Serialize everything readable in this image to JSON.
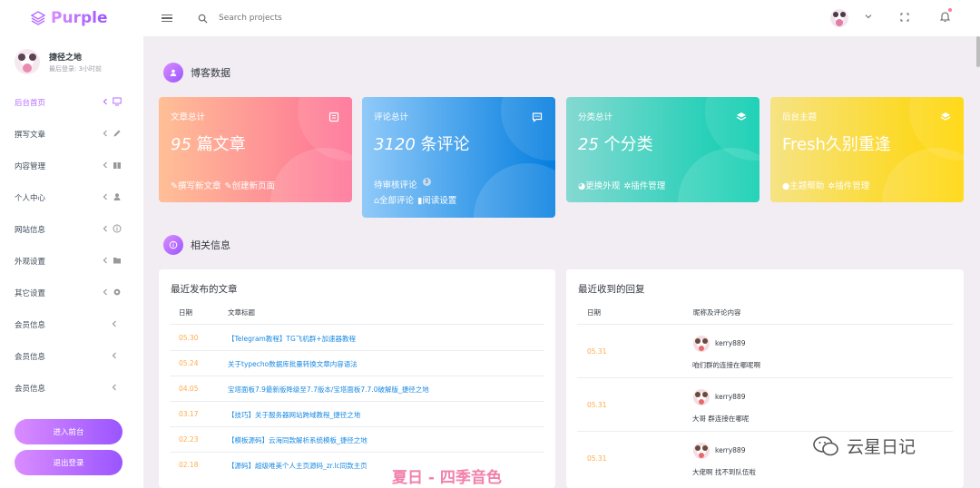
{
  "app": {
    "name": "Purple"
  },
  "search": {
    "placeholder": "Search projects"
  },
  "profile": {
    "name": "捷径之地",
    "status": "最后登录: 3小时前"
  },
  "sidebar": {
    "items": [
      {
        "label": "后台首页",
        "icon": "monitor-icon"
      },
      {
        "label": "撰写文章",
        "icon": "pencil-icon"
      },
      {
        "label": "内容管理",
        "icon": "book-icon"
      },
      {
        "label": "个人中心",
        "icon": "user-icon"
      },
      {
        "label": "网站信息",
        "icon": "info-icon"
      },
      {
        "label": "外观设置",
        "icon": "folder-icon"
      },
      {
        "label": "其它设置",
        "icon": "gear-icon"
      },
      {
        "label": "会员信息",
        "icon": ""
      },
      {
        "label": "会员信息",
        "icon": ""
      },
      {
        "label": "会员信息",
        "icon": ""
      }
    ],
    "front_button": "进入前台",
    "logout_button": "退出登录"
  },
  "blog_section": {
    "title": "博客数据"
  },
  "stats": [
    {
      "label": "文章总计",
      "number": "95",
      "unit": " 篇文章",
      "links": [
        "撰写新文章",
        "创建新页面"
      ],
      "color": "#fe7c96"
    },
    {
      "label": "评论总计",
      "number": "3120",
      "unit": " 条评论",
      "pending_label": "待审核评论",
      "pending_count": "3",
      "links": [
        "全部评论",
        "阅读设置"
      ],
      "color": "#198ae3"
    },
    {
      "label": "分类总计",
      "number": "25",
      "unit": " 个分类",
      "links": [
        "更换外观",
        "插件管理"
      ],
      "color": "#1bcfb4"
    },
    {
      "label": "后台主题",
      "value": "Fresh久别重逢",
      "links": [
        "主题帮助",
        "插件管理"
      ],
      "color": "#fed713"
    }
  ],
  "info_section": {
    "title": "相关信息"
  },
  "recent_posts": {
    "title": "最近发布的文章",
    "headers": [
      "日期",
      "文章标题"
    ],
    "rows": [
      {
        "date": "05.30",
        "title": "【Telegram教程】TG飞机群+加速器教程"
      },
      {
        "date": "05.24",
        "title": "关于typecho数据库批量转换文章内容语法"
      },
      {
        "date": "04.05",
        "title": "宝塔面板7.9最新版降级至7.7版本/宝塔面板7.7.0破解版_捷径之地"
      },
      {
        "date": "03.17",
        "title": "【技巧】关于服务器网站跨域教程_捷径之地"
      },
      {
        "date": "02.23",
        "title": "【模板源码】云海同款解析系统模板_捷径之地"
      },
      {
        "date": "02.18",
        "title": "【源码】超级唯美个人主页源码_zr.lc同款主页"
      }
    ]
  },
  "recent_replies": {
    "title": "最近收到的回复",
    "headers": [
      "日期",
      "昵称及评论内容"
    ],
    "rows": [
      {
        "date": "05.31",
        "name": "kerry889",
        "text": "咱们群的连接在哪呢啊"
      },
      {
        "date": "05.31",
        "name": "kerry889",
        "text": "大哥 群连接在哪呢"
      },
      {
        "date": "05.31",
        "name": "kerry889",
        "text": "大佬啊 找不到队伍啦"
      }
    ]
  },
  "watermarks": {
    "brand": "云星日记",
    "bottom": "夏日 - 四季音色"
  }
}
